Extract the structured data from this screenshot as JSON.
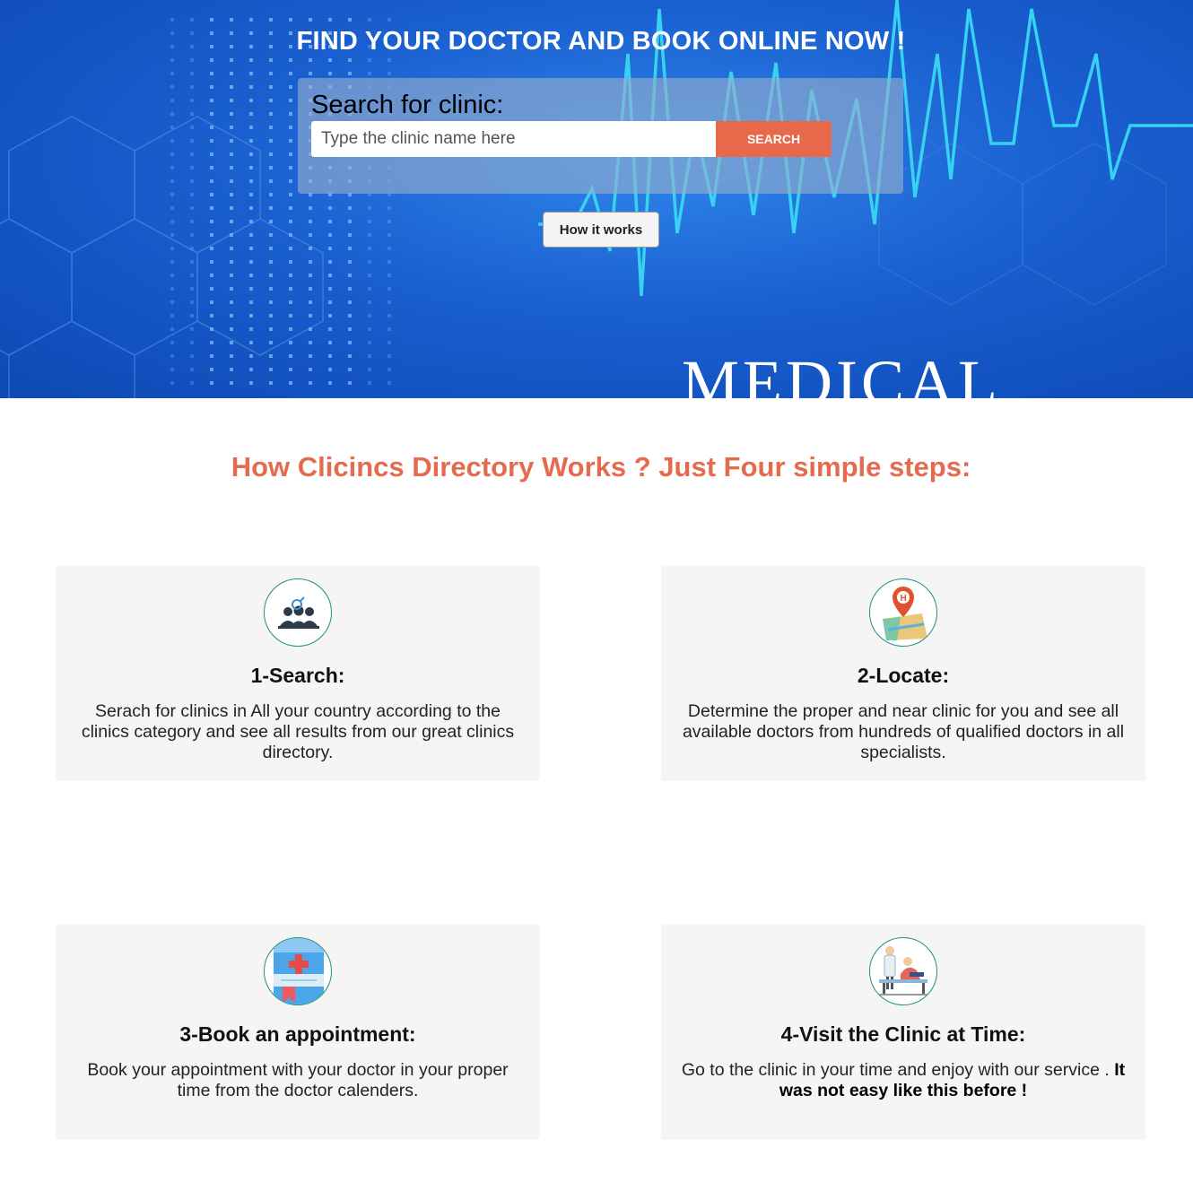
{
  "hero": {
    "title": "FIND YOUR DOCTOR AND BOOK ONLINE NOW !",
    "search_heading": "Search for clinic:",
    "search_placeholder": "Type the clinic name here",
    "search_button": "SEARCH",
    "how_button": "How it works",
    "background_word": "MEDICAL"
  },
  "section": {
    "title": "How Clicincs Directory Works ? Just Four simple steps:"
  },
  "steps": [
    {
      "icon": "doctors-search-icon",
      "title": "1-Search:",
      "text": "Serach for clinics in All your country according to the clinics category and see all results from our great clinics directory."
    },
    {
      "icon": "map-location-pin-icon",
      "title": "2-Locate:",
      "text": "Determine the proper and near clinic for you and see all available doctors from hundreds of qualified doctors in all specialists."
    },
    {
      "icon": "booking-book-icon",
      "title": "3-Book an appointment:",
      "text": "Book your appointment with your doctor in your proper time from the doctor calenders."
    },
    {
      "icon": "clinic-visit-icon",
      "title": "4-Visit the Clinic at Time:",
      "text": "Go to the clinic in your time and enjoy with our service .",
      "text_bold": "It was not easy like this before !"
    }
  ],
  "colors": {
    "accent": "#e56b4f",
    "button": "#e8684a",
    "hero_blue": "#1a5fd0",
    "card_bg": "#f5f5f4",
    "icon_border": "#1f8f82"
  }
}
